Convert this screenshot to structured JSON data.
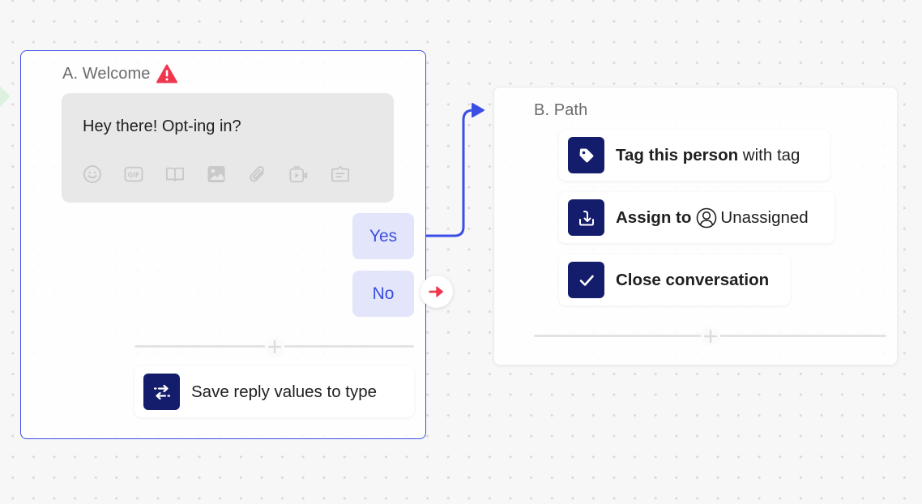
{
  "canvas": {
    "accent_color": "#3b4ee6",
    "action_icon_bg": "#141d6b",
    "warning_color": "#f0364f"
  },
  "node_a": {
    "title": "A. Welcome",
    "status_icon": "warning-triangle-icon",
    "message": {
      "text": "Hey there! Opt-ing in?",
      "tools": [
        {
          "icon": "emoji-icon"
        },
        {
          "icon": "gif-icon"
        },
        {
          "icon": "article-book-icon"
        },
        {
          "icon": "image-icon"
        },
        {
          "icon": "attachment-paperclip-icon"
        },
        {
          "icon": "video-icon"
        },
        {
          "icon": "app-card-icon"
        }
      ]
    },
    "replies": [
      {
        "label": "Yes",
        "connected_to": "B. Path"
      },
      {
        "label": "No",
        "connected_to": null
      }
    ],
    "add_step_icon": "plus-icon",
    "actions": [
      {
        "icon": "swap-arrows-icon",
        "bold": "Save reply values to",
        "normal": " type"
      }
    ]
  },
  "node_b": {
    "title": "B. Path",
    "actions": [
      {
        "icon": "tag-icon",
        "bold": "Tag this person",
        "normal": " with tag"
      },
      {
        "icon": "assign-inbox-icon",
        "bold": "Assign to",
        "assignee_icon": "person-circle-icon",
        "normal": "Unassigned"
      },
      {
        "icon": "checkmark-icon",
        "bold": "Close conversation",
        "normal": ""
      }
    ],
    "add_step_icon": "plus-icon"
  }
}
